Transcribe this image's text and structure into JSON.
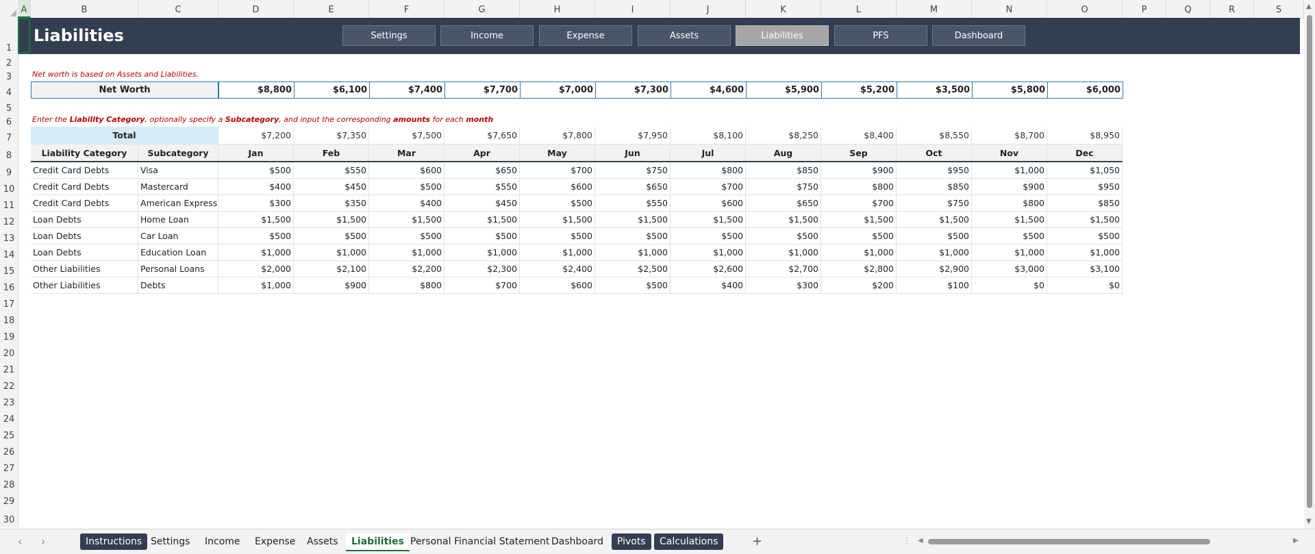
{
  "columns": [
    "A",
    "B",
    "C",
    "D",
    "E",
    "F",
    "G",
    "H",
    "I",
    "J",
    "K",
    "L",
    "M",
    "N",
    "O",
    "P",
    "Q",
    "R",
    "S"
  ],
  "rows": [
    "1",
    "2",
    "3",
    "4",
    "5",
    "6",
    "7",
    "8",
    "9",
    "10",
    "11",
    "12",
    "13",
    "14",
    "15",
    "16",
    "17",
    "18",
    "19",
    "20",
    "21",
    "22",
    "23",
    "24",
    "25",
    "26",
    "27",
    "28",
    "29",
    "30"
  ],
  "banner": {
    "title": "Liabilities",
    "nav": [
      "Settings",
      "Income",
      "Expense",
      "Assets",
      "Liabilities",
      "PFS",
      "Dashboard"
    ],
    "active_nav": "Liabilities"
  },
  "note1": "Net worth is based on Assets and Liabilities.",
  "note2": {
    "p1": "Enter the ",
    "b1": "Liability Category",
    "p2": ", optionally specify a ",
    "b2": "Subcategory",
    "p3": ", and input the corresponding ",
    "b3": "amounts",
    "p4": " for each ",
    "b4": "month"
  },
  "net_worth": {
    "label": "Net Worth",
    "values": [
      "$8,800",
      "$6,100",
      "$7,400",
      "$7,700",
      "$7,000",
      "$7,300",
      "$4,600",
      "$5,900",
      "$5,200",
      "$3,500",
      "$5,800",
      "$6,000"
    ]
  },
  "total": {
    "label": "Total",
    "values": [
      "$7,200",
      "$7,350",
      "$7,500",
      "$7,650",
      "$7,800",
      "$7,950",
      "$8,100",
      "$8,250",
      "$8,400",
      "$8,550",
      "$8,700",
      "$8,950"
    ]
  },
  "table": {
    "headers": [
      "Liability Category",
      "Subcategory",
      "Jan",
      "Feb",
      "Mar",
      "Apr",
      "May",
      "Jun",
      "Jul",
      "Aug",
      "Sep",
      "Oct",
      "Nov",
      "Dec"
    ],
    "rows": [
      [
        "Credit Card Debts",
        "Visa",
        "$500",
        "$550",
        "$600",
        "$650",
        "$700",
        "$750",
        "$800",
        "$850",
        "$900",
        "$950",
        "$1,000",
        "$1,050"
      ],
      [
        "Credit Card Debts",
        "Mastercard",
        "$400",
        "$450",
        "$500",
        "$550",
        "$600",
        "$650",
        "$700",
        "$750",
        "$800",
        "$850",
        "$900",
        "$950"
      ],
      [
        "Credit Card Debts",
        "American Express",
        "$300",
        "$350",
        "$400",
        "$450",
        "$500",
        "$550",
        "$600",
        "$650",
        "$700",
        "$750",
        "$800",
        "$850"
      ],
      [
        "Loan Debts",
        "Home Loan",
        "$1,500",
        "$1,500",
        "$1,500",
        "$1,500",
        "$1,500",
        "$1,500",
        "$1,500",
        "$1,500",
        "$1,500",
        "$1,500",
        "$1,500",
        "$1,500"
      ],
      [
        "Loan Debts",
        "Car Loan",
        "$500",
        "$500",
        "$500",
        "$500",
        "$500",
        "$500",
        "$500",
        "$500",
        "$500",
        "$500",
        "$500",
        "$500"
      ],
      [
        "Loan Debts",
        "Education Loan",
        "$1,000",
        "$1,000",
        "$1,000",
        "$1,000",
        "$1,000",
        "$1,000",
        "$1,000",
        "$1,000",
        "$1,000",
        "$1,000",
        "$1,000",
        "$1,000"
      ],
      [
        "Other Liabilities",
        "Personal Loans",
        "$2,000",
        "$2,100",
        "$2,200",
        "$2,300",
        "$2,400",
        "$2,500",
        "$2,600",
        "$2,700",
        "$2,800",
        "$2,900",
        "$3,000",
        "$3,100"
      ],
      [
        "Other Liabilities",
        "Debts",
        "$1,000",
        "$900",
        "$800",
        "$700",
        "$600",
        "$500",
        "$400",
        "$300",
        "$200",
        "$100",
        "$0",
        "$0"
      ]
    ]
  },
  "sheet_tabs": [
    {
      "label": "Instructions",
      "style": "dark"
    },
    {
      "label": "Settings",
      "style": "plain"
    },
    {
      "label": "Income",
      "style": "plain"
    },
    {
      "label": "Expense",
      "style": "plain"
    },
    {
      "label": "Assets",
      "style": "plain"
    },
    {
      "label": "Liabilities",
      "style": "active"
    },
    {
      "label": "Personal Financial Statement",
      "style": "plain"
    },
    {
      "label": "Dashboard",
      "style": "plain"
    },
    {
      "label": "Pivots",
      "style": "dark"
    },
    {
      "label": "Calculations",
      "style": "dark"
    }
  ],
  "icons": {
    "prev_sheet": "chevron-left-icon",
    "next_sheet": "chevron-right-icon",
    "add_sheet": "plus-icon"
  },
  "colors": {
    "banner": "#333f50",
    "nav_active": "#a6a6a6",
    "note": "#c00000",
    "total_fill": "#d6ecf8",
    "accent_green": "#1e7145"
  }
}
